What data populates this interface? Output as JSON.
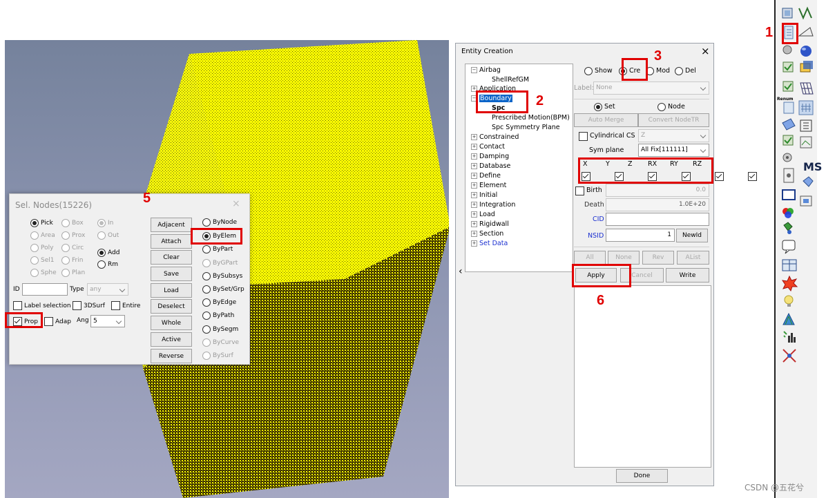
{
  "sel_nodes": {
    "title": "Sel. Nodes(15226)",
    "close": "×",
    "pick_options": [
      {
        "label": "Pick",
        "checked": true,
        "enabled": true
      },
      {
        "label": "Box",
        "checked": false,
        "enabled": false
      },
      {
        "label": "In",
        "checked": true,
        "enabled": false
      },
      {
        "label": "Area",
        "checked": false,
        "enabled": false
      },
      {
        "label": "Prox",
        "checked": false,
        "enabled": false
      },
      {
        "label": "Out",
        "checked": false,
        "enabled": false
      },
      {
        "label": "Poly",
        "checked": false,
        "enabled": false
      },
      {
        "label": "Circ",
        "checked": false,
        "enabled": false
      },
      {
        "label": "Add",
        "checked": true,
        "enabled": true
      },
      {
        "label": "Sel1",
        "checked": false,
        "enabled": false
      },
      {
        "label": "Frin",
        "checked": false,
        "enabled": false
      },
      {
        "label": "Rm",
        "checked": false,
        "enabled": true
      },
      {
        "label": "Sphe",
        "checked": false,
        "enabled": false
      },
      {
        "label": "Plan",
        "checked": false,
        "enabled": false
      }
    ],
    "id_label": "ID",
    "id_value": "",
    "type_label": "Type",
    "type_value": "any",
    "label_selection": "Label selection",
    "surf3d": "3DSurf",
    "entire": "Entire",
    "prop": "Prop",
    "adap": "Adap",
    "ang_label": "Ang",
    "ang_value": "5",
    "buttons": [
      "Adjacent",
      "Attach",
      "Clear",
      "Save",
      "Load",
      "Deselect",
      "Whole",
      "Active",
      "Reverse"
    ],
    "by_options": [
      {
        "label": "ByNode",
        "checked": false,
        "enabled": true
      },
      {
        "label": "ByElem",
        "checked": true,
        "enabled": true
      },
      {
        "label": "ByPart",
        "checked": false,
        "enabled": true
      },
      {
        "label": "ByGPart",
        "checked": false,
        "enabled": false
      },
      {
        "label": "BySubsys",
        "checked": false,
        "enabled": true
      },
      {
        "label": "BySet/Grp",
        "checked": false,
        "enabled": true
      },
      {
        "label": "ByEdge",
        "checked": false,
        "enabled": true
      },
      {
        "label": "ByPath",
        "checked": false,
        "enabled": true
      },
      {
        "label": "BySegm",
        "checked": false,
        "enabled": true
      },
      {
        "label": "ByCurve",
        "checked": false,
        "enabled": false
      },
      {
        "label": "BySurf",
        "checked": false,
        "enabled": false
      }
    ]
  },
  "entity": {
    "title": "Entity Creation",
    "close": "×",
    "tree": [
      {
        "label": "Airbag",
        "expander": "−"
      },
      {
        "label": "ShellRefGM",
        "child": true
      },
      {
        "label": "Application",
        "expander": "+"
      },
      {
        "label": "Boundary",
        "expander": "−",
        "selected": true
      },
      {
        "label": "Spc",
        "child": true,
        "bold": true
      },
      {
        "label": "Prescribed Motion(BPM)",
        "child": true
      },
      {
        "label": "Spc Symmetry Plane",
        "child": true
      },
      {
        "label": "Constrained",
        "expander": "+"
      },
      {
        "label": "Contact",
        "expander": "+"
      },
      {
        "label": "Damping",
        "expander": "+"
      },
      {
        "label": "Database",
        "expander": "+"
      },
      {
        "label": "Define",
        "expander": "+"
      },
      {
        "label": "Element",
        "expander": "+"
      },
      {
        "label": "Initial",
        "expander": "+"
      },
      {
        "label": "Integration",
        "expander": "+"
      },
      {
        "label": "Load",
        "expander": "+"
      },
      {
        "label": "Rigidwall",
        "expander": "+"
      },
      {
        "label": "Section",
        "expander": "+"
      },
      {
        "label": "Set Data",
        "expander": "+",
        "link": true
      }
    ],
    "collapse_arrow": "‹",
    "modes": [
      {
        "label": "Show",
        "checked": false
      },
      {
        "label": "Cre",
        "checked": true
      },
      {
        "label": "Mod",
        "checked": false
      },
      {
        "label": "Del",
        "checked": false
      }
    ],
    "label_label": "Label:",
    "label_value": "None",
    "set_label": "Set",
    "node_label": "Node",
    "auto_merge": "Auto Merge",
    "convert_nodetr": "Convert NodeTR",
    "cyl_cs": "Cylindrical CS",
    "cyl_value": "Z",
    "sym_plane_label": "Sym plane",
    "sym_plane_value": "All Fix[111111]",
    "dofs": [
      "X",
      "Y",
      "Z",
      "RX",
      "RY",
      "RZ"
    ],
    "birth_label": "Birth",
    "birth_value": "0.0",
    "death_label": "Death",
    "death_value": "1.0E+20",
    "cid_label": "CID",
    "cid_value": "",
    "nsid_label": "NSID",
    "nsid_value": "1",
    "newid": "NewId",
    "all": "All",
    "none": "None",
    "rev": "Rev",
    "alist": "AList",
    "apply": "Apply",
    "cancel": "Cancel",
    "write": "Write",
    "done": "Done"
  },
  "annotations": [
    "1",
    "2",
    "3",
    "5",
    "6"
  ],
  "toolbar": {
    "renum_label": "Renum",
    "ms_label": "MS",
    "icons": [
      "part-icon",
      "spring-icon",
      "entity-creation-icon",
      "measure-icon",
      "sphere-icon",
      "cube-icon",
      "check-icon",
      "mesh-icon",
      "renum-icon",
      "grid-icon",
      "layer-icon",
      "frame-icon",
      "list-icon",
      "image-icon",
      "gear-icon",
      "ms-icon",
      "node-icon",
      "tag-icon",
      "window-icon",
      "color-icon",
      "tool-icon",
      "comment-icon",
      "table-icon",
      "explosion-icon",
      "bulb-icon",
      "tree-icon",
      "plot-icon",
      "cross-icon"
    ]
  },
  "footer": "CSDN @五花兮",
  "colors": {
    "cube": "#ffff00",
    "annotation": "#e00000",
    "link": "#1a2fd0",
    "selection": "#0a64c8"
  }
}
